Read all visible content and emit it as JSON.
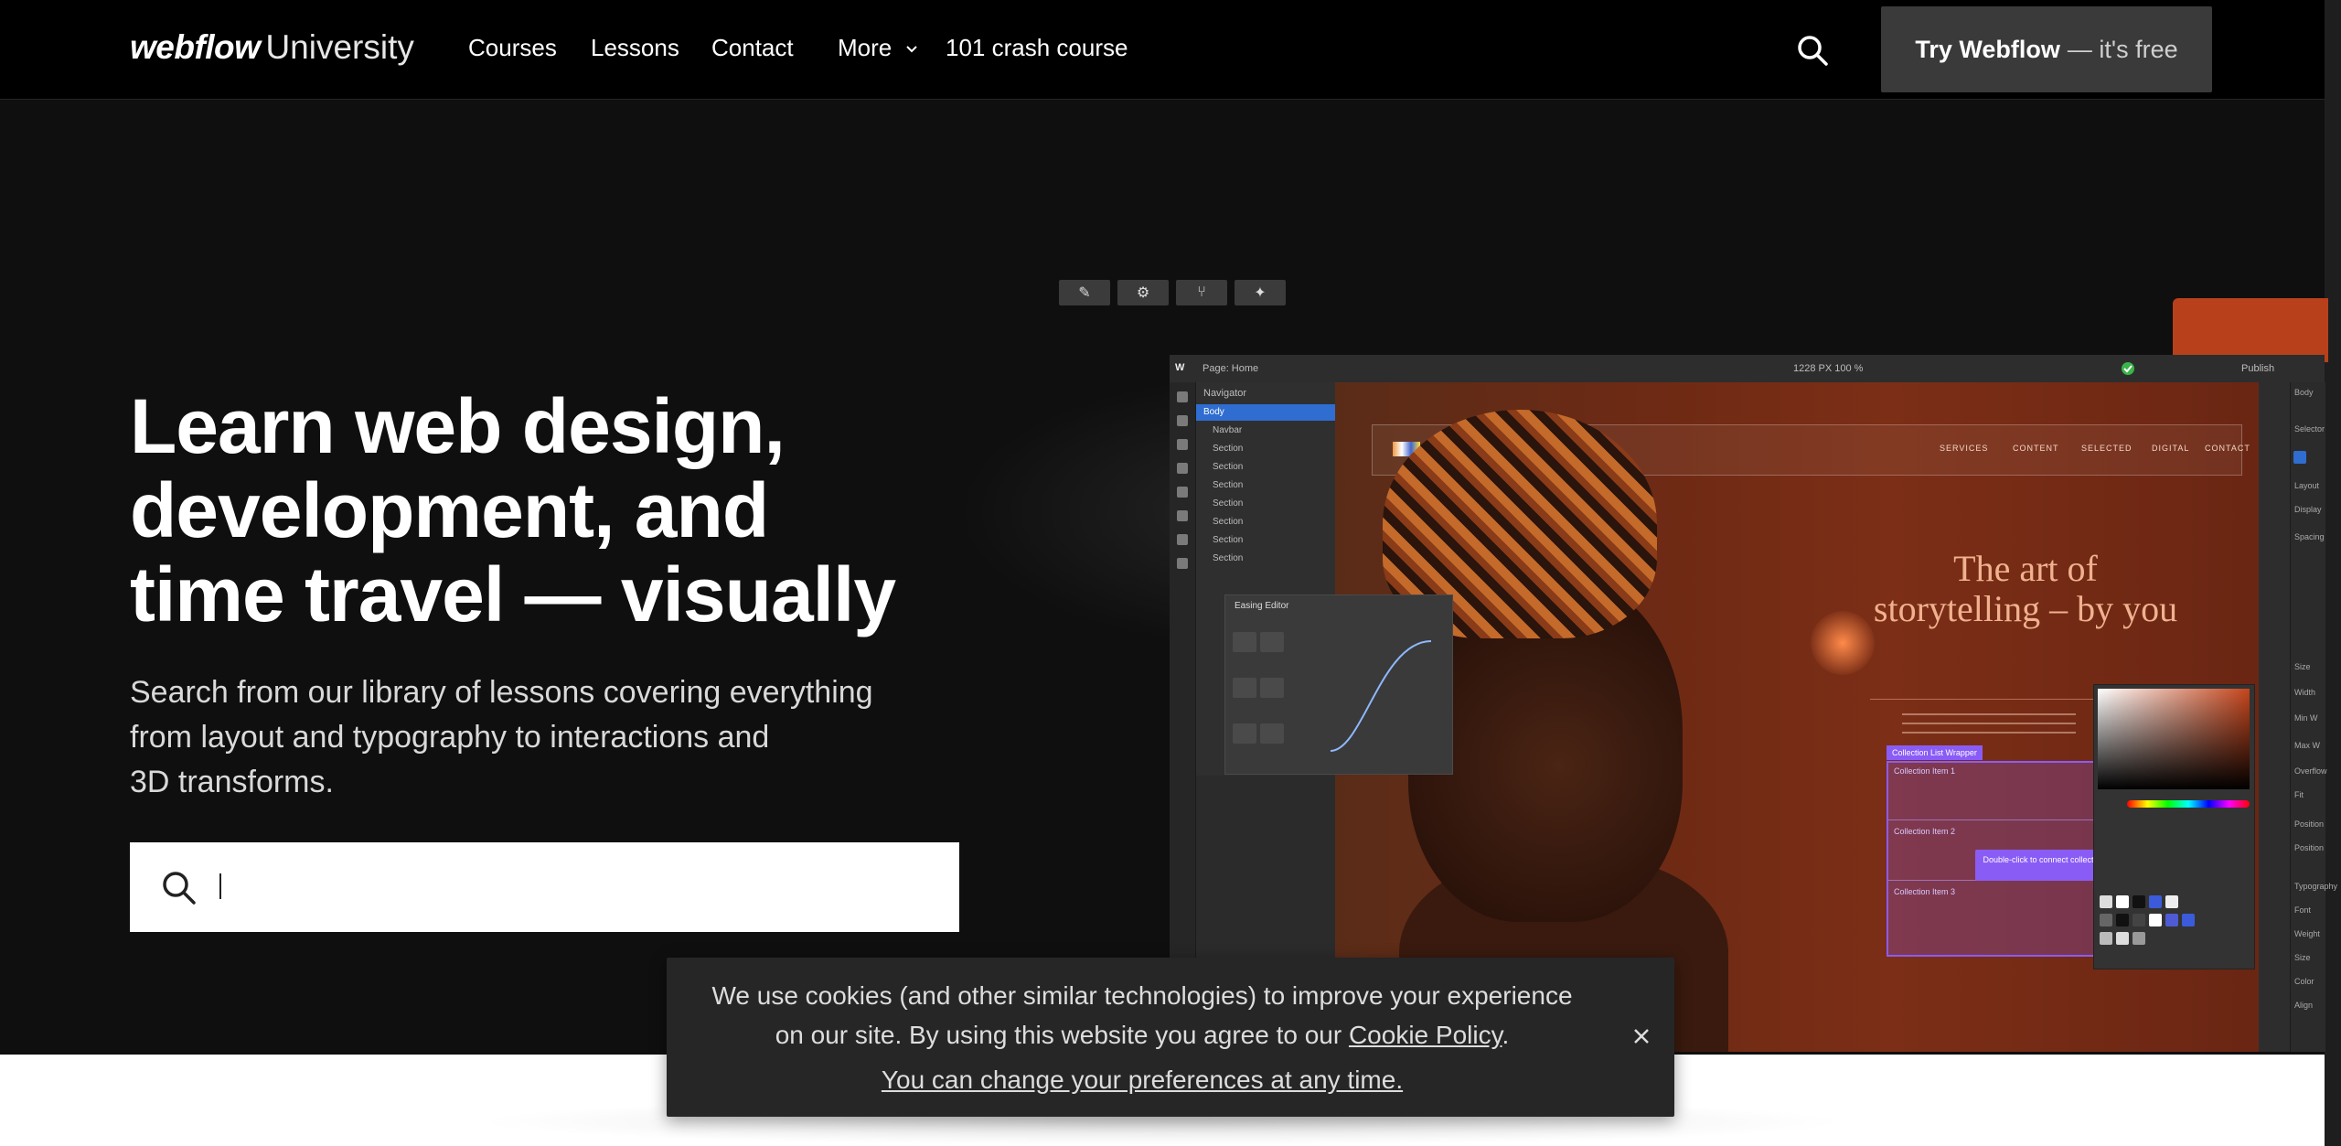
{
  "nav": {
    "logo_word": "webflow",
    "logo_suffix": "University",
    "links": [
      "Courses",
      "Lessons",
      "Contact",
      "More",
      "101 crash course"
    ],
    "cta_strong": "Try Webflow",
    "cta_rest": "— it's free"
  },
  "hero": {
    "headline_lines": [
      "Learn web design,",
      "development, and",
      "time travel — visually"
    ],
    "subcopy_lines": [
      "Search from our library of lessons covering everything",
      "from layout and typography to interactions and",
      "3D transforms."
    ],
    "search_value": ""
  },
  "designer": {
    "page_label": "Page: Home",
    "canvas_size": "1228 PX  100 %",
    "publish": "Publish",
    "navigator_title": "Navigator",
    "navigator_items": [
      "Body",
      "Navbar",
      "Section",
      "Section",
      "Section",
      "Section",
      "Section",
      "Section",
      "Section"
    ],
    "easing_title": "Easing Editor",
    "canvas_nav_links": [
      "SERVICES",
      "CONTENT",
      "SELECTED",
      "DIGITAL",
      "CONTACT"
    ],
    "canvas_heading_lines": [
      "The art of",
      "storytelling – by you"
    ],
    "collection_wrapper": "Collection List Wrapper",
    "collection_items": [
      "Collection Item 1",
      "Collection Item 2",
      "Collection Item 3"
    ],
    "collection_cta": "Double-click to connect collection",
    "right_panel_labels": [
      "Body",
      "Selector",
      "Layout",
      "Display",
      "Spacing",
      "Size",
      "Width",
      "Min W",
      "Max W",
      "Overflow",
      "Fit",
      "Position",
      "Position",
      "Typography",
      "Font",
      "Weight",
      "Size",
      "Color",
      "Align"
    ]
  },
  "cookie": {
    "line1": "We use cookies (and other similar technologies) to improve your experience",
    "line2_prefix": "on our site. By using this website you agree to our ",
    "policy_link": "Cookie Policy",
    "line2_suffix": ".",
    "preferences_link": "You can change your preferences at any time."
  },
  "icons": {
    "search": "search-icon",
    "chevron": "chevron-down-icon",
    "close": "close-icon"
  },
  "colors": {
    "nav_bg": "#000000",
    "hero_bg": "#0f0f0f",
    "cta_bg": "#3a3a3a",
    "cookie_bg": "#262626",
    "canvas_accent": "#b8401b",
    "selection_blue": "#2f6dd0",
    "collection_purple": "#8a5cf6"
  }
}
